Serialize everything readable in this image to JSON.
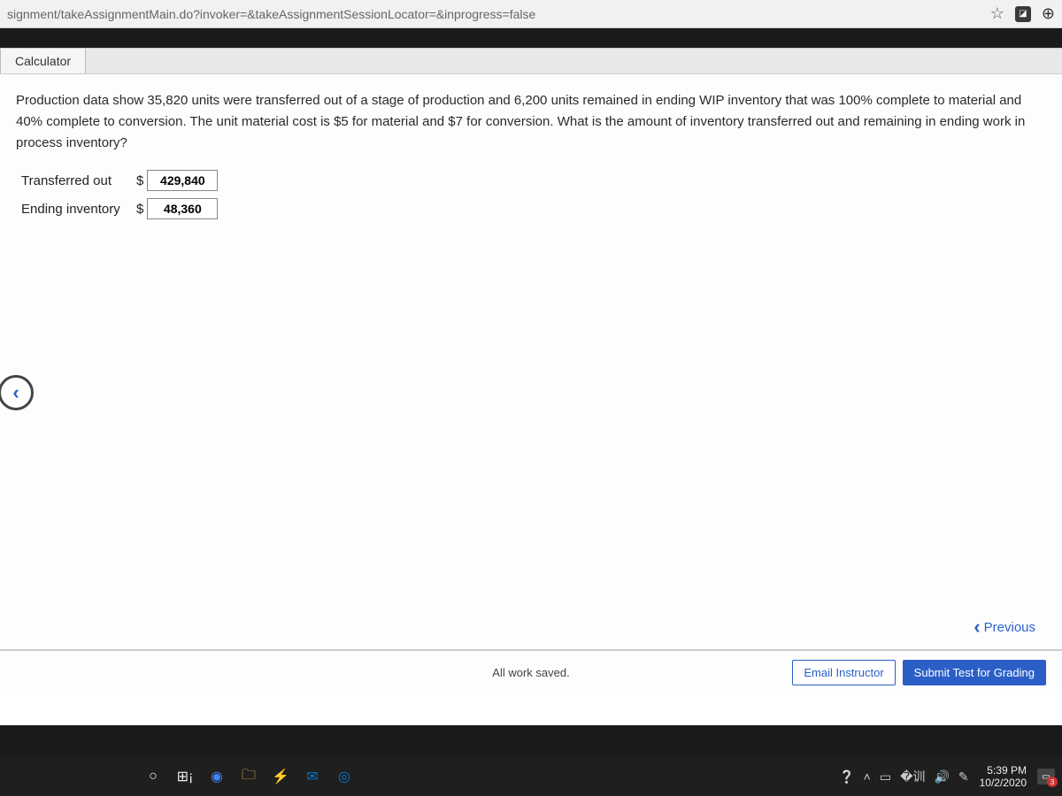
{
  "browser": {
    "url_fragment": "signment/takeAssignmentMain.do?invoker=&takeAssignmentSessionLocator=&inprogress=false"
  },
  "toolbar": {
    "calculator": "Calculator"
  },
  "question": {
    "text": "Production data show 35,820 units were transferred out of a stage of production and 6,200 units remained in ending WIP inventory that was 100% complete to material and 40% complete to conversion. The unit material cost is $5 for material and $7 for conversion. What is the amount of inventory transferred out and remaining in ending work in process inventory?"
  },
  "answers": {
    "rows": [
      {
        "label": "Transferred out",
        "currency": "$",
        "value": "429,840"
      },
      {
        "label": "Ending inventory",
        "currency": "$",
        "value": "48,360"
      }
    ]
  },
  "nav": {
    "previous": "Previous"
  },
  "footer": {
    "saved": "All work saved.",
    "email": "Email Instructor",
    "submit": "Submit Test for Grading"
  },
  "taskbar": {
    "time": "5:39 PM",
    "date": "10/2/2020",
    "notif_count": "3"
  }
}
